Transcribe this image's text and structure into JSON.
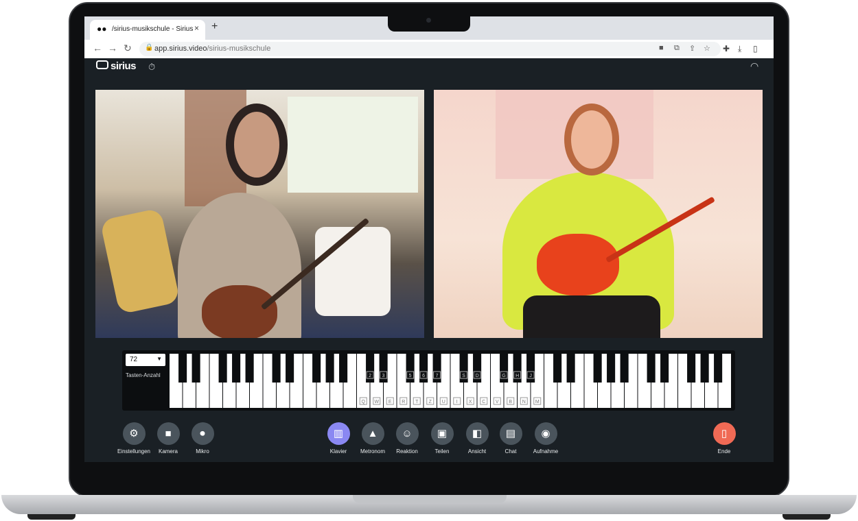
{
  "browser": {
    "tab_title": "/sirius-musikschule - Sirius",
    "tab_icon": "sirius-logo-icon",
    "close": "×",
    "new_tab": "+",
    "url_host": "app.sirius.video",
    "url_path": "/sirius-musikschule"
  },
  "app": {
    "logo": "sirius"
  },
  "piano": {
    "key_count": "72",
    "key_count_label": "Tasten-Anzahl",
    "lower_labels": [
      "Q",
      "W",
      "E",
      "R",
      "T",
      "Z",
      "U",
      "I",
      "X",
      "C",
      "V",
      "B",
      "N",
      "M"
    ],
    "upper_labels": [
      "2",
      "3",
      "5",
      "6",
      "7",
      "S",
      "D",
      "G",
      "H",
      "J"
    ]
  },
  "controls": {
    "left": [
      {
        "label": "Einstellungen",
        "icon": "gear-icon"
      },
      {
        "label": "Kamera",
        "icon": "video-camera-icon"
      },
      {
        "label": "Mikro",
        "icon": "microphone-icon"
      }
    ],
    "center": [
      {
        "label": "Klavier",
        "icon": "piano-icon",
        "active": true
      },
      {
        "label": "Metronom",
        "icon": "metronome-icon"
      },
      {
        "label": "Reaktion",
        "icon": "smiley-icon"
      },
      {
        "label": "Teilen",
        "icon": "share-screen-icon"
      },
      {
        "label": "Ansicht",
        "icon": "view-layout-icon"
      },
      {
        "label": "Chat",
        "icon": "chat-icon"
      },
      {
        "label": "Aufnahme",
        "icon": "record-icon"
      }
    ],
    "end": {
      "label": "Ende",
      "icon": "exit-door-icon"
    }
  },
  "colors": {
    "app_bg": "#1a2025",
    "active_button": "#8a88f2",
    "end_button": "#f06a55",
    "control_button": "#4a545c"
  }
}
